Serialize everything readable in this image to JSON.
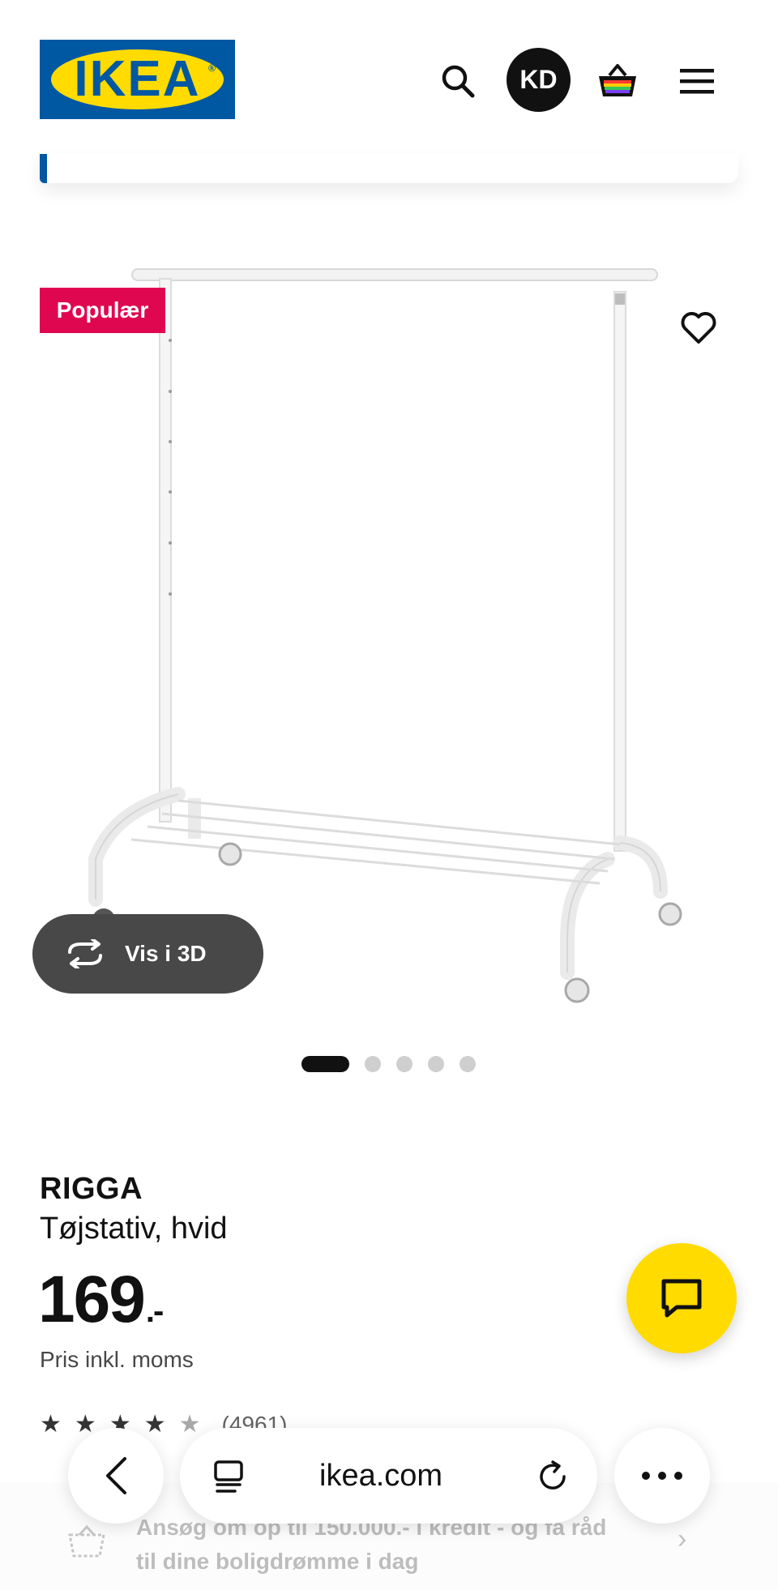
{
  "header": {
    "logo_text": "IKEA",
    "logo_reg": "®",
    "avatar_initials": "KD",
    "brand_blue": "#0058a3",
    "brand_yellow": "#ffdb00"
  },
  "product": {
    "badge": "Populær",
    "view_3d_label": "Vis i 3D",
    "gallery_dots": 5,
    "gallery_active_index": 0,
    "name": "RIGGA",
    "description": "Tøjstativ, hvid",
    "price_main": "169",
    "price_suffix": ".-",
    "vat_note": "Pris inkl. moms",
    "rating_count": "(4961)",
    "badge_color": "#e00751"
  },
  "promo": {
    "text": "Ansøg om op til 150.000.- i kredit - og få råd til dine boligdrømme i dag"
  },
  "browser": {
    "url": "ikea.com"
  },
  "icons": {
    "search": "search-icon",
    "basket": "shopping-basket-icon",
    "menu": "hamburger-menu-icon",
    "heart": "heart-icon",
    "rotate": "rotate-3d-icon",
    "chat": "chat-icon",
    "back": "chevron-left-icon",
    "tabs": "tabs-icon",
    "reload": "reload-icon",
    "more": "more-dots-icon"
  }
}
